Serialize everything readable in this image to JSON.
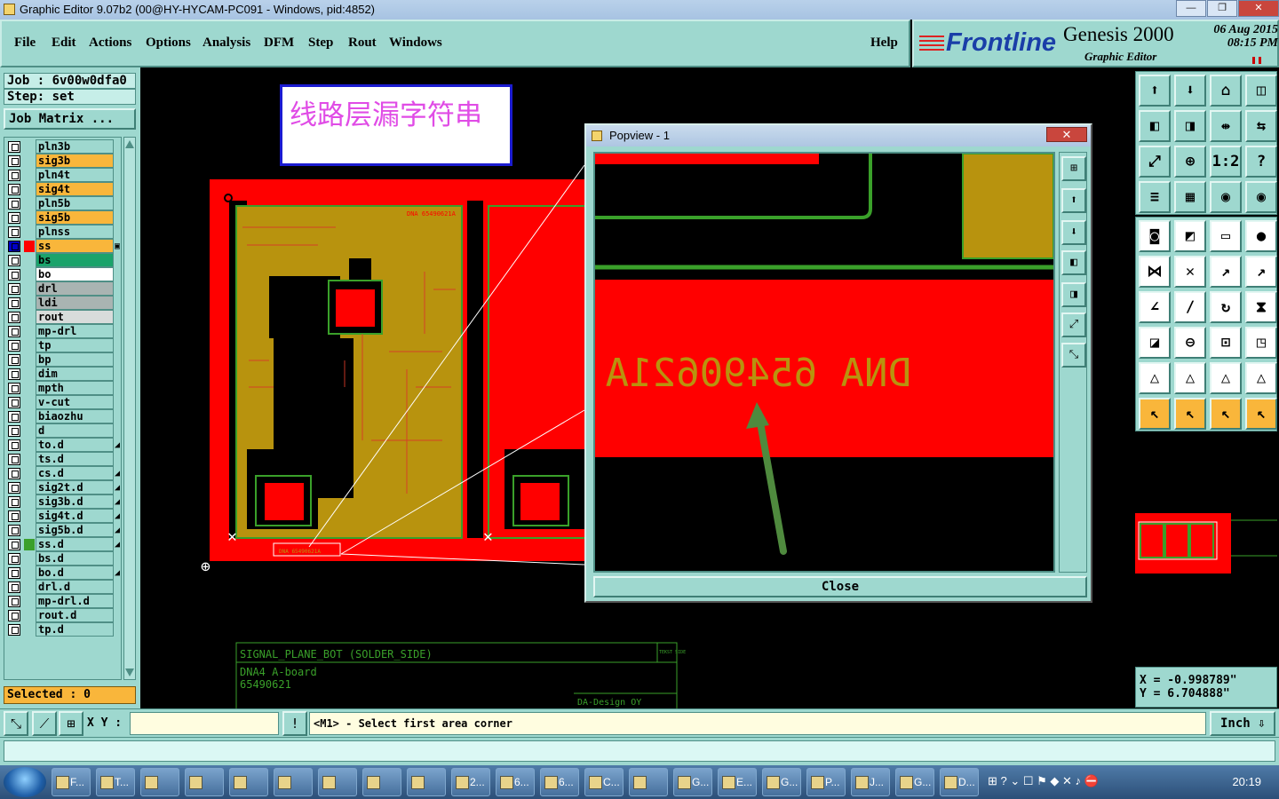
{
  "window": {
    "title": "Graphic Editor 9.07b2 (00@HY-HYCAM-PC091 - Windows, pid:4852)",
    "buttons": [
      "—",
      "❐",
      "✕"
    ]
  },
  "menu": {
    "items": [
      "File",
      "Edit",
      "Actions",
      "Options",
      "Analysis",
      "DFM",
      "Step",
      "Rout",
      "Windows"
    ],
    "help": "Help"
  },
  "brand": {
    "logo": "Frontline",
    "product": "Genesis 2000",
    "subtitle": "Graphic Editor",
    "date": "06 Aug 2015",
    "time": "08:15 PM"
  },
  "job": {
    "job_label": "Job : 6v00w0dfa0",
    "step_label": "Step: set",
    "matrix_button": "Job Matrix ..."
  },
  "layers": [
    {
      "name": "pln3b",
      "color": "#9ed8cf",
      "mark": ""
    },
    {
      "name": "sig3b",
      "color": "#f9b63b",
      "mark": ""
    },
    {
      "name": "pln4t",
      "color": "#9ed8cf",
      "mark": ""
    },
    {
      "name": "sig4t",
      "color": "#f9b63b",
      "mark": ""
    },
    {
      "name": "pln5b",
      "color": "#9ed8cf",
      "mark": ""
    },
    {
      "name": "sig5b",
      "color": "#f9b63b",
      "mark": ""
    },
    {
      "name": "plnss",
      "color": "#9ed8cf",
      "mark": ""
    },
    {
      "name": "ss",
      "color": "#f9b63b",
      "mark": "▣",
      "active": true
    },
    {
      "name": "bs",
      "color": "#1aa36b",
      "mark": ""
    },
    {
      "name": "bo",
      "color": "#ffffff",
      "mark": ""
    },
    {
      "name": "drl",
      "color": "#a9b4b2",
      "mark": ""
    },
    {
      "name": "ldi",
      "color": "#a9b4b2",
      "mark": ""
    },
    {
      "name": "rout",
      "color": "#d8dcdb",
      "mark": ""
    },
    {
      "name": "mp-drl",
      "color": "#9ed8cf",
      "mark": ""
    },
    {
      "name": "tp",
      "color": "#9ed8cf",
      "mark": ""
    },
    {
      "name": "bp",
      "color": "#9ed8cf",
      "mark": ""
    },
    {
      "name": "dim",
      "color": "#9ed8cf",
      "mark": ""
    },
    {
      "name": "mpth",
      "color": "#9ed8cf",
      "mark": ""
    },
    {
      "name": "v-cut",
      "color": "#9ed8cf",
      "mark": ""
    },
    {
      "name": "biaozhu",
      "color": "#9ed8cf",
      "mark": ""
    },
    {
      "name": "d",
      "color": "#9ed8cf",
      "mark": ""
    },
    {
      "name": "to.d",
      "color": "#9ed8cf",
      "mark": "◢"
    },
    {
      "name": "ts.d",
      "color": "#9ed8cf",
      "mark": ""
    },
    {
      "name": "cs.d",
      "color": "#9ed8cf",
      "mark": "◢"
    },
    {
      "name": "sig2t.d",
      "color": "#9ed8cf",
      "mark": "◢"
    },
    {
      "name": "sig3b.d",
      "color": "#9ed8cf",
      "mark": "◢"
    },
    {
      "name": "sig4t.d",
      "color": "#9ed8cf",
      "mark": "◢"
    },
    {
      "name": "sig5b.d",
      "color": "#9ed8cf",
      "mark": "◢"
    },
    {
      "name": "ss.d",
      "color": "#9ed8cf",
      "mark": "◢",
      "green": true
    },
    {
      "name": "bs.d",
      "color": "#9ed8cf",
      "mark": ""
    },
    {
      "name": "bo.d",
      "color": "#9ed8cf",
      "mark": "◢"
    },
    {
      "name": "drl.d",
      "color": "#9ed8cf",
      "mark": ""
    },
    {
      "name": "mp-drl.d",
      "color": "#9ed8cf",
      "mark": ""
    },
    {
      "name": "rout.d",
      "color": "#9ed8cf",
      "mark": ""
    },
    {
      "name": "tp.d",
      "color": "#9ed8cf",
      "mark": ""
    }
  ],
  "selected": "Selected : 0",
  "annotation": "线路层漏字符串",
  "board": {
    "top_label": "DNA 65490621A",
    "title_block": {
      "line1": "SIGNAL_PLANE_BOT (SOLDER_SIDE)",
      "line2": "DNA4 A-board",
      "line3": "65490621",
      "line4": "DA-Design OY",
      "corner": "TEKST SIDE"
    }
  },
  "popview": {
    "title": "Popview - 1",
    "close_x": "✕",
    "mirrored_text": "DNA 65490621A",
    "close_button": "Close",
    "tools": [
      "⊞",
      "⬆",
      "⬇",
      "◧",
      "◨",
      "⤢",
      "⤡"
    ]
  },
  "right_tools": {
    "group1": [
      "⬆",
      "⬇",
      "⌂",
      "◫",
      "◧",
      "◨",
      "⇹",
      "⇆",
      "⤢",
      "⊕",
      "1:2",
      "?",
      "≡",
      "▦",
      "◉",
      "◉"
    ],
    "group2": [
      "◙",
      "◩",
      "▭",
      "●",
      "⋈",
      "✕",
      "↗",
      "↗",
      "∠",
      "∕",
      "↻",
      "⧗",
      "◪",
      "⊖",
      "⊡",
      "◳",
      "△",
      "△",
      "△",
      "△",
      "↖",
      "↖",
      "↖",
      "↖"
    ]
  },
  "coords": {
    "x": "X = -0.998789\"",
    "y": "Y = 6.704888\""
  },
  "bottom": {
    "tools": [
      "⤡",
      "⟋",
      "⊞"
    ],
    "xy_label": "X Y :",
    "xy_value": "",
    "alert": "!",
    "prompt": "<M1> - Select first area corner",
    "unit": "Inch"
  },
  "taskbar": {
    "items": [
      "F...",
      "T...",
      "",
      "",
      "",
      "",
      "",
      "",
      "",
      "2...",
      "6...",
      "6...",
      "C...",
      "",
      "G...",
      "E...",
      "G...",
      "P...",
      "J...",
      "G...",
      "D..."
    ],
    "clock": "20:19"
  }
}
